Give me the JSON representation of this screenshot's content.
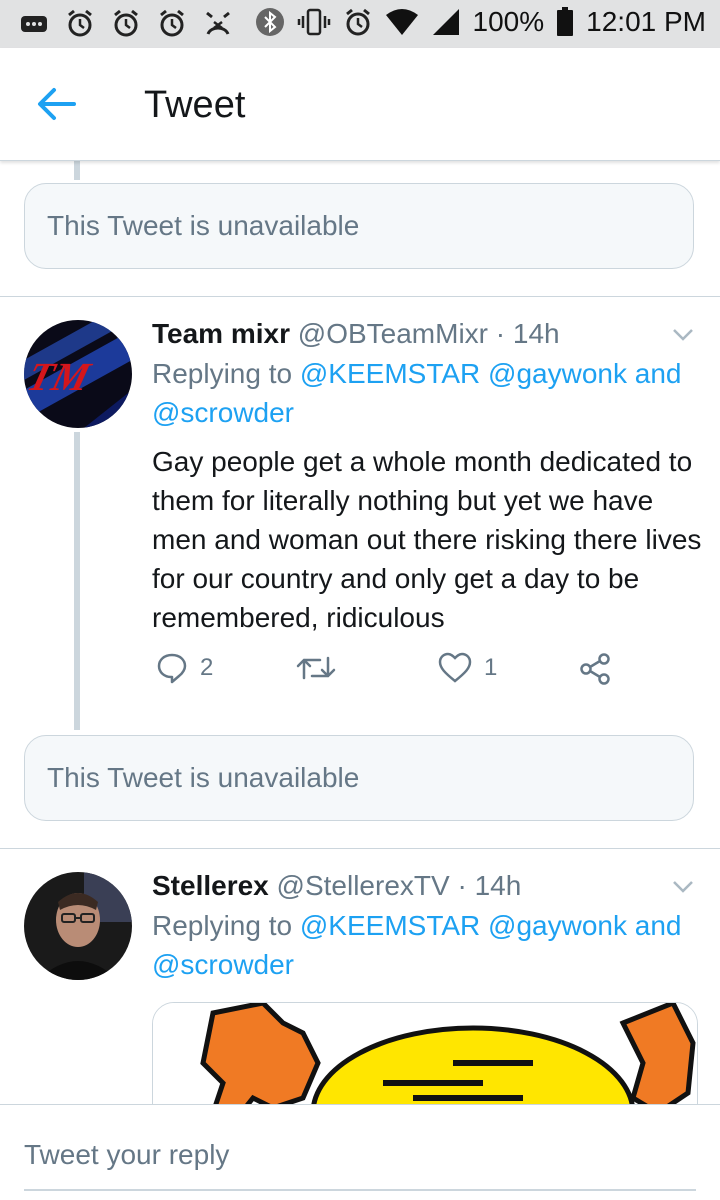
{
  "status_bar": {
    "icons": [
      "notification-dots-icon",
      "alarm-icon",
      "alarm-icon",
      "alarm-icon",
      "missed-alarm-icon",
      "bluetooth-icon",
      "vibrate-icon",
      "alarm-icon",
      "wifi-icon",
      "signal-icon",
      "battery-icon"
    ],
    "battery": "100%",
    "time": "12:01 PM"
  },
  "header": {
    "title": "Tweet",
    "back_icon": "back-arrow-icon"
  },
  "unavailable_1": {
    "text": "This Tweet is unavailable"
  },
  "tweet1": {
    "name": "Team mixr",
    "handle": "@OBTeamMixr",
    "dot": "·",
    "time": "14h",
    "replying_prefix": "Replying to",
    "mention1": "@KEEMSTAR",
    "mention2": "@gaywonk",
    "and_word": "and",
    "mention3": "@scrowder",
    "text": "Gay people get a whole month dedicated to them for literally nothing but yet we have men and woman out there risking there lives for our country and only get a day to be remembered, ridiculous",
    "reply_count": "2",
    "retweet_count": "",
    "like_count": "1"
  },
  "unavailable_2": {
    "text": "This Tweet is unavailable"
  },
  "tweet2": {
    "name": "Stellerex",
    "handle": "@StellerexTV",
    "dot": "·",
    "time": "14h",
    "replying_prefix": "Replying to",
    "mention1": "@KEEMSTAR",
    "mention2": "@gaywonk",
    "and_word": "and",
    "mention3": "@scrowder"
  },
  "composer": {
    "placeholder": "Tweet your reply"
  },
  "colors": {
    "accent": "#1da1f2",
    "muted": "#657786",
    "border": "#ccd6dd"
  }
}
